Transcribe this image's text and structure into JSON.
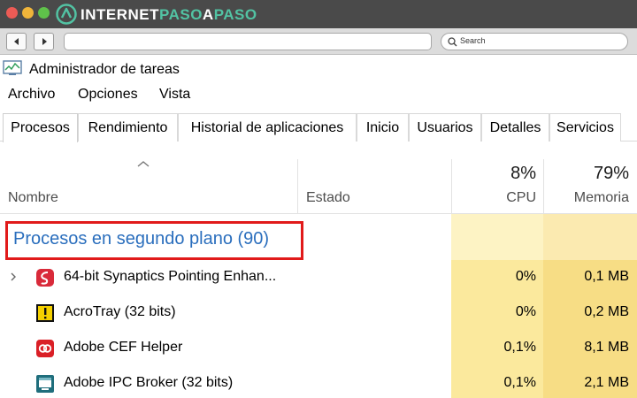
{
  "colors": {
    "accent_link": "#2a6ebd",
    "highlight_box": "#e11a1a",
    "cpu_column_bg": "#fdf3c4",
    "mem_column_bg": "#fbeab0",
    "cpu_cell_bg": "#fbe99d",
    "mem_cell_bg": "#f7dd85",
    "brand_accent": "#52c3a3"
  },
  "browser": {
    "logo_text_a": "INTERNET",
    "logo_text_b": "PASO",
    "logo_text_c": "A",
    "logo_text_d": "PASO",
    "search_placeholder": "Search"
  },
  "window": {
    "title": "Administrador de tareas"
  },
  "menu": [
    "Archivo",
    "Opciones",
    "Vista"
  ],
  "tabs": [
    {
      "label": "Procesos",
      "active": true
    },
    {
      "label": "Rendimiento",
      "active": false
    },
    {
      "label": "Historial de aplicaciones",
      "active": false
    },
    {
      "label": "Inicio",
      "active": false
    },
    {
      "label": "Usuarios",
      "active": false
    },
    {
      "label": "Detalles",
      "active": false
    },
    {
      "label": "Servicios",
      "active": false
    }
  ],
  "columns": {
    "name": "Nombre",
    "status": "Estado",
    "cpu_pct": "8%",
    "cpu": "CPU",
    "mem_pct": "79%",
    "mem": "Memoria"
  },
  "group": {
    "title": "Procesos en segundo plano (90)"
  },
  "processes": [
    {
      "name": "64-bit Synaptics Pointing Enhan...",
      "cpu": "0%",
      "memory": "0,1 MB",
      "expandable": true,
      "icon": "synaptics-icon"
    },
    {
      "name": "AcroTray (32 bits)",
      "cpu": "0%",
      "memory": "0,2 MB",
      "expandable": false,
      "icon": "acrotray-icon"
    },
    {
      "name": "Adobe CEF Helper",
      "cpu": "0,1%",
      "memory": "8,1 MB",
      "expandable": false,
      "icon": "adobe-cc-icon"
    },
    {
      "name": "Adobe IPC Broker (32 bits)",
      "cpu": "0,1%",
      "memory": "2,1 MB",
      "expandable": false,
      "icon": "adobe-ipc-icon"
    }
  ]
}
